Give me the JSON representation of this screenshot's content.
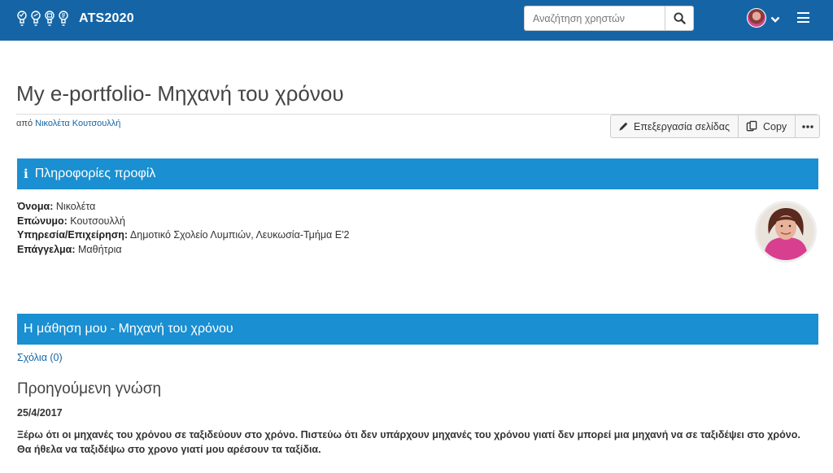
{
  "header": {
    "brand": "ATS2020",
    "search_placeholder": "Αναζήτηση χρηστών",
    "icons": [
      "lightbulb-logo-icon",
      "search-icon",
      "avatar",
      "chevron-down-icon",
      "hamburger-menu-icon"
    ]
  },
  "page": {
    "title": "My e-portfolio- Μηχανή του χρόνου",
    "author_prefix": "από",
    "author_name": "Νικολέτα Κουτσουλλή"
  },
  "actions": {
    "edit_label": "Επεξεργασία σελίδας",
    "copy_label": "Copy"
  },
  "profile_section": {
    "title": "Πληροφορίες προφίλ",
    "fields": [
      {
        "label": "Όνομα:",
        "value": "Νικολέτα"
      },
      {
        "label": "Επώνυμο:",
        "value": "Κουτσουλλή"
      },
      {
        "label": "Υπηρεσία/Επιχείρηση:",
        "value": "Δημοτικό Σχολείο Λυμπιών, Λευκωσία-Τμήμα Ε'2"
      },
      {
        "label": "Επάγγελμα:",
        "value": "Μαθήτρια"
      }
    ]
  },
  "learning_section": {
    "title": "Η μάθηση μου - Μηχανή του χρόνου",
    "comments_link": "Σχόλια (0)",
    "subheading": "Προηγούμενη γνώση",
    "date": "25/4/2017",
    "text": "Ξέρω ότι οι μηχανές του χρόνου σε ταξιδεύουν στο χρόνο. Πιστεύω ότι δεν υπάρχουν μηχανές του χρόνου γιατί δεν μπορεί μια μηχανή να σε ταξιδέψει στο χρόνο. Θα ήθελα να ταξιδέψω στο χρονο γιατί μου αρέσουν τα ταξίδια."
  },
  "colors": {
    "topbar": "#1565a6",
    "section_bar": "#1a8fd1",
    "link": "#1565a6"
  }
}
